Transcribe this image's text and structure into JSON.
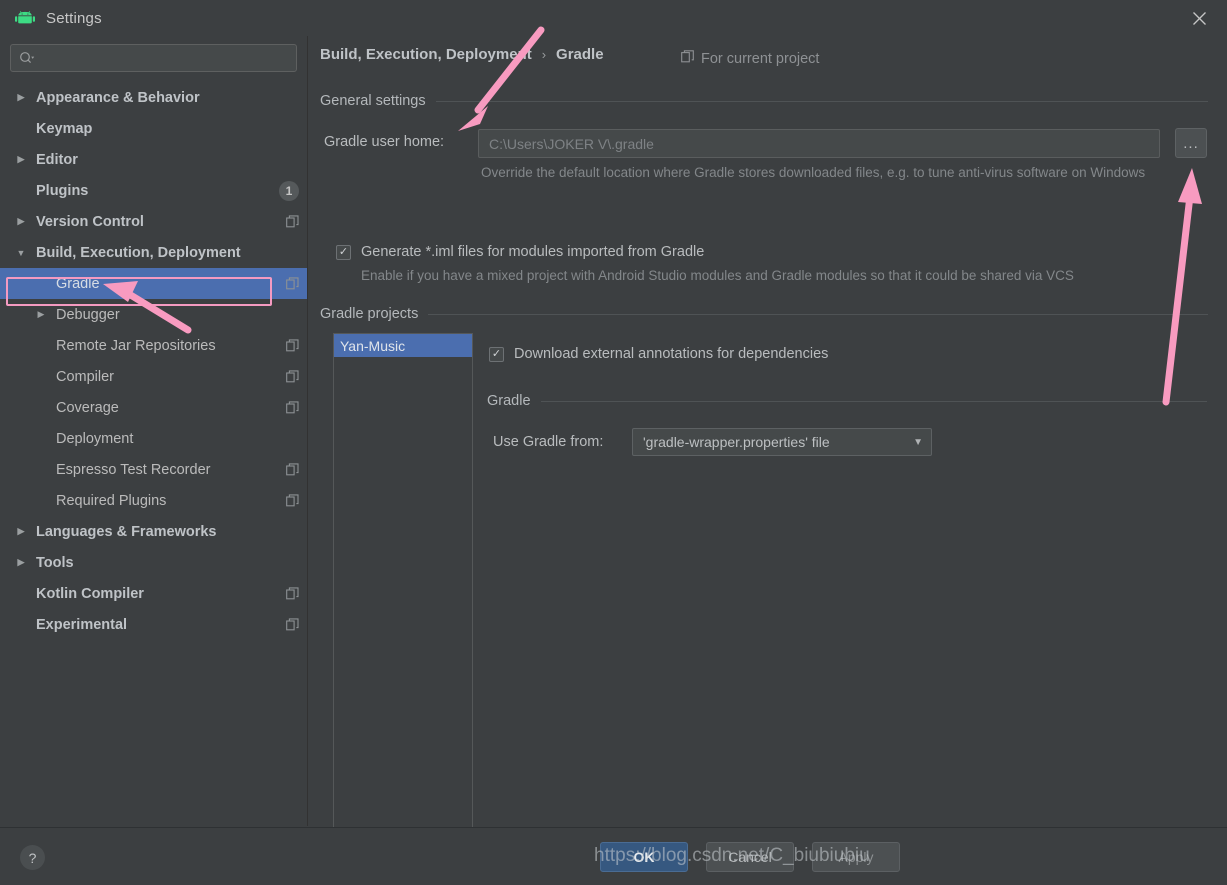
{
  "window": {
    "title": "Settings",
    "app_icon": "android-robot-icon",
    "close_icon": "close-icon",
    "accent_selection": "#4b6eaf",
    "annotation_color": "#f49ac1"
  },
  "search": {
    "placeholder": "",
    "value": "",
    "icon": "search-icon"
  },
  "sidebar": {
    "items": [
      {
        "label": "Appearance & Behavior",
        "indent": 0,
        "arrow": "collapsed",
        "bold": true,
        "selected": false,
        "badge": null,
        "copy_icon": false
      },
      {
        "label": "Keymap",
        "indent": 0,
        "arrow": "none",
        "bold": true,
        "selected": false,
        "badge": null,
        "copy_icon": false
      },
      {
        "label": "Editor",
        "indent": 0,
        "arrow": "collapsed",
        "bold": true,
        "selected": false,
        "badge": null,
        "copy_icon": false
      },
      {
        "label": "Plugins",
        "indent": 0,
        "arrow": "none",
        "bold": true,
        "selected": false,
        "badge": "1",
        "copy_icon": false
      },
      {
        "label": "Version Control",
        "indent": 0,
        "arrow": "collapsed",
        "bold": true,
        "selected": false,
        "badge": null,
        "copy_icon": true
      },
      {
        "label": "Build, Execution, Deployment",
        "indent": 0,
        "arrow": "expanded",
        "bold": true,
        "selected": false,
        "badge": null,
        "copy_icon": false
      },
      {
        "label": "Gradle",
        "indent": 1,
        "arrow": "none",
        "bold": false,
        "selected": true,
        "badge": null,
        "copy_icon": true
      },
      {
        "label": "Debugger",
        "indent": 1,
        "arrow": "collapsed",
        "bold": false,
        "selected": false,
        "badge": null,
        "copy_icon": false
      },
      {
        "label": "Remote Jar Repositories",
        "indent": 1,
        "arrow": "none",
        "bold": false,
        "selected": false,
        "badge": null,
        "copy_icon": true
      },
      {
        "label": "Compiler",
        "indent": 1,
        "arrow": "none",
        "bold": false,
        "selected": false,
        "badge": null,
        "copy_icon": true
      },
      {
        "label": "Coverage",
        "indent": 1,
        "arrow": "none",
        "bold": false,
        "selected": false,
        "badge": null,
        "copy_icon": true
      },
      {
        "label": "Deployment",
        "indent": 1,
        "arrow": "none",
        "bold": false,
        "selected": false,
        "badge": null,
        "copy_icon": false
      },
      {
        "label": "Espresso Test Recorder",
        "indent": 1,
        "arrow": "none",
        "bold": false,
        "selected": false,
        "badge": null,
        "copy_icon": true
      },
      {
        "label": "Required Plugins",
        "indent": 1,
        "arrow": "none",
        "bold": false,
        "selected": false,
        "badge": null,
        "copy_icon": true
      },
      {
        "label": "Languages & Frameworks",
        "indent": 0,
        "arrow": "collapsed",
        "bold": true,
        "selected": false,
        "badge": null,
        "copy_icon": false
      },
      {
        "label": "Tools",
        "indent": 0,
        "arrow": "collapsed",
        "bold": true,
        "selected": false,
        "badge": null,
        "copy_icon": false
      },
      {
        "label": "Kotlin Compiler",
        "indent": 0,
        "arrow": "none",
        "bold": true,
        "selected": false,
        "badge": null,
        "copy_icon": true
      },
      {
        "label": "Experimental",
        "indent": 0,
        "arrow": "none",
        "bold": true,
        "selected": false,
        "badge": null,
        "copy_icon": true
      }
    ]
  },
  "main": {
    "breadcrumb": {
      "parent": "Build, Execution, Deployment",
      "separator": "›",
      "current": "Gradle"
    },
    "for_current_project": {
      "label": "For current project",
      "icon": "copy-icon"
    },
    "general_settings": {
      "section_title": "General settings",
      "gradle_user_home_label": "Gradle user home:",
      "gradle_user_home_value": "C:\\Users\\JOKER V\\.gradle",
      "browse_button_label": "...",
      "hint": "Override the default location where Gradle stores downloaded files, e.g. to tune anti-virus software on Windows",
      "generate_iml": {
        "label": "Generate *.iml files for modules imported from Gradle",
        "checked": true,
        "hint": "Enable if you have a mixed project with Android Studio modules and Gradle modules so that it could be shared via VCS"
      }
    },
    "gradle_projects": {
      "section_title": "Gradle projects",
      "projects": [
        {
          "name": "Yan-Music",
          "selected": true
        }
      ],
      "download_annotations": {
        "label": "Download external annotations for dependencies",
        "checked": true
      },
      "gradle_group_title": "Gradle",
      "use_gradle_from_label": "Use Gradle from:",
      "use_gradle_from_value": "'gradle-wrapper.properties' file"
    }
  },
  "footer": {
    "help_label": "?",
    "ok_label": "OK",
    "cancel_label": "Cancel",
    "apply_label": "Apply"
  },
  "watermark": {
    "text": "https://blog.csdn.net/C_biubiubiu"
  }
}
